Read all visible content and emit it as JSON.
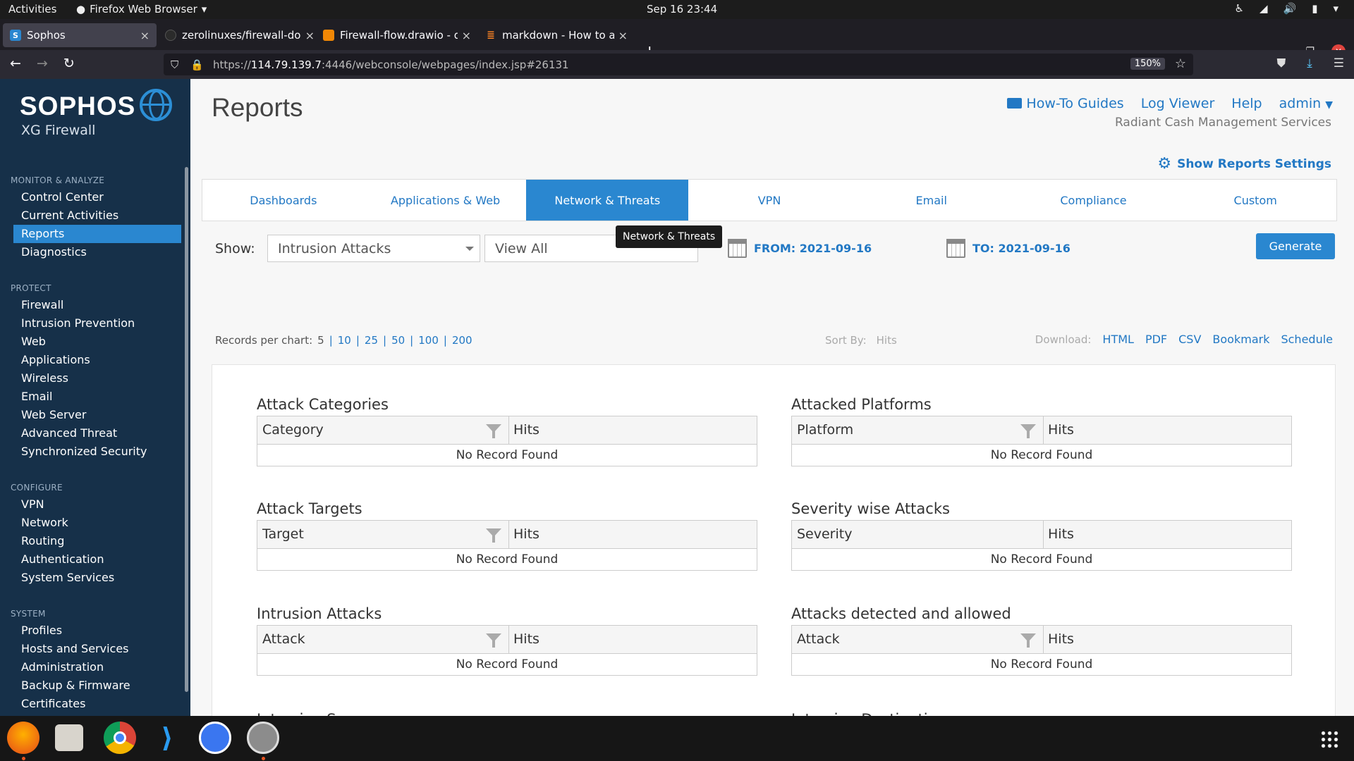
{
  "system": {
    "activities": "Activities",
    "app_name": "Firefox Web Browser",
    "clock": "Sep 16  23:44"
  },
  "browser": {
    "tabs": [
      {
        "label": "Sophos",
        "favicon": "S"
      },
      {
        "label": "zerolinuxes/firewall-docs",
        "favicon": "github-icon"
      },
      {
        "label": "Firewall-flow.drawio - dia",
        "favicon": "drawio-icon"
      },
      {
        "label": "markdown - How to add i",
        "favicon": "stackoverflow-icon"
      }
    ],
    "url_prefix": "https://",
    "url_host": "114.79.139.7",
    "url_rest": ":4446/webconsole/webpages/index.jsp#26131",
    "zoom": "150%"
  },
  "sidebar": {
    "brand": "SOPHOS",
    "product": "XG Firewall",
    "sections": [
      {
        "title": "MONITOR & ANALYZE",
        "items": [
          "Control Center",
          "Current Activities",
          "Reports",
          "Diagnostics"
        ]
      },
      {
        "title": "PROTECT",
        "items": [
          "Firewall",
          "Intrusion Prevention",
          "Web",
          "Applications",
          "Wireless",
          "Email",
          "Web Server",
          "Advanced Threat",
          "Synchronized Security"
        ]
      },
      {
        "title": "CONFIGURE",
        "items": [
          "VPN",
          "Network",
          "Routing",
          "Authentication",
          "System Services"
        ]
      },
      {
        "title": "SYSTEM",
        "items": [
          "Profiles",
          "Hosts and Services",
          "Administration",
          "Backup & Firmware",
          "Certificates"
        ]
      }
    ],
    "active_item": "Reports"
  },
  "header": {
    "title": "Reports",
    "links": [
      "How-To Guides",
      "Log Viewer",
      "Help",
      "admin"
    ],
    "org": "Radiant Cash Management Services",
    "settings_label": "Show Reports Settings"
  },
  "report_tabs": [
    "Dashboards",
    "Applications & Web",
    "Network & Threats",
    "VPN",
    "Email",
    "Compliance",
    "Custom"
  ],
  "active_tab": "Network & Threats",
  "tooltip": "Network & Threats",
  "filters": {
    "show_label": "Show:",
    "report_select": "Intrusion Attacks",
    "view_select": "View All",
    "from_label": "FROM: 2021-09-16",
    "to_label": "TO: 2021-09-16",
    "generate_label": "Generate"
  },
  "toolbar": {
    "records_label": "Records per chart:",
    "records_options": [
      "5",
      "10",
      "25",
      "50",
      "100",
      "200"
    ],
    "sort_label": "Sort By:",
    "sort_value": "Hits",
    "download_label": "Download:",
    "download_options": [
      "HTML",
      "PDF",
      "CSV",
      "Bookmark",
      "Schedule"
    ]
  },
  "widgets": [
    {
      "title": "Attack Categories",
      "col1": "Category",
      "col2": "Hits",
      "filterable": true,
      "empty": "No Record Found"
    },
    {
      "title": "Attacked Platforms",
      "col1": "Platform",
      "col2": "Hits",
      "filterable": true,
      "empty": "No Record Found"
    },
    {
      "title": "Attack Targets",
      "col1": "Target",
      "col2": "Hits",
      "filterable": true,
      "empty": "No Record Found"
    },
    {
      "title": "Severity wise Attacks",
      "col1": "Severity",
      "col2": "Hits",
      "filterable": false,
      "empty": "No Record Found"
    },
    {
      "title": "Intrusion Attacks",
      "col1": "Attack",
      "col2": "Hits",
      "filterable": true,
      "empty": "No Record Found"
    },
    {
      "title": "Attacks detected and allowed",
      "col1": "Attack",
      "col2": "Hits",
      "filterable": true,
      "empty": "No Record Found"
    }
  ],
  "cut_titles": [
    "Intrusion Source",
    "Intrusion Destination"
  ],
  "taskbar": [
    "firefox-icon",
    "files-icon",
    "chrome-icon",
    "vscode-icon",
    "signal-icon",
    "software-updater-icon",
    "app-grid-icon"
  ],
  "colors": {
    "accent": "#2a87d0",
    "sidebar": "#163049",
    "link": "#2278c4"
  }
}
